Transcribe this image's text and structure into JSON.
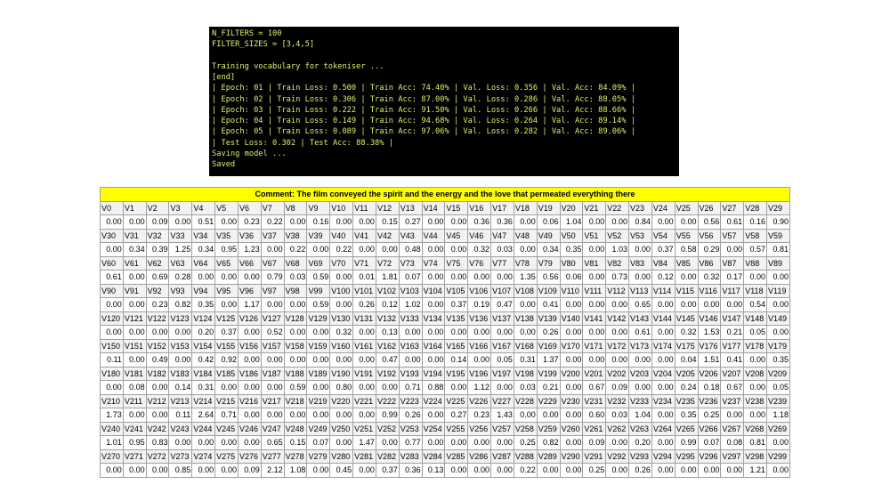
{
  "terminal": {
    "lines": [
      "N_FILTERS = 100",
      "FILTER_SIZES = [3,4,5]",
      "",
      "Training vocabulary for tokeniser ...",
      "[end]",
      "| Epoch: 01 | Train Loss: 0.500 | Train Acc: 74.40% | Val. Loss: 0.356 | Val. Acc: 84.09% |",
      "| Epoch: 02 | Train Loss: 0.306 | Train Acc: 87.00% | Val. Loss: 0.286 | Val. Acc: 88.05% |",
      "| Epoch: 03 | Train Loss: 0.222 | Train Acc: 91.50% | Val. Loss: 0.266 | Val. Acc: 88.66% |",
      "| Epoch: 04 | Train Loss: 0.149 | Train Acc: 94.68% | Val. Loss: 0.264 | Val. Acc: 89.14% |",
      "| Epoch: 05 | Train Loss: 0.089 | Train Acc: 97.06% | Val. Loss: 0.282 | Val. Acc: 89.06% |",
      "| Test Loss: 0.302 | Test Acc: 88.38% |",
      "Saving model ...",
      "Saved"
    ]
  },
  "sheet": {
    "comment": "Comment: The film conveyed the spirit and the energy and the love that permeated everything there",
    "values": [
      [
        "0.00",
        "0.00",
        "0.09",
        "0.00",
        "0.51",
        "0.00",
        "0.23",
        "0.22",
        "0.00",
        "0.16",
        "0.00",
        "0.00",
        "0.15",
        "0.27",
        "0.00",
        "0.00",
        "0.36",
        "0.36",
        "0.00",
        "0.06",
        "1.04",
        "0.00",
        "0.00",
        "0.84",
        "0.00",
        "0.00",
        "0.56",
        "0.61",
        "0.16",
        "0.90"
      ],
      [
        "0.00",
        "0.34",
        "0.39",
        "1.25",
        "0.34",
        "0.95",
        "1.23",
        "0.00",
        "0.22",
        "0.00",
        "0.22",
        "0.00",
        "0.00",
        "0.48",
        "0.00",
        "0.00",
        "0.32",
        "0.03",
        "0.00",
        "0.34",
        "0.35",
        "0.00",
        "1.03",
        "0.00",
        "0.37",
        "0.58",
        "0.29",
        "0.00",
        "0.57",
        "0.81"
      ],
      [
        "0.61",
        "0.00",
        "0.69",
        "0.28",
        "0.00",
        "0.00",
        "0.00",
        "0.79",
        "0.03",
        "0.59",
        "0.00",
        "0.01",
        "1.81",
        "0.07",
        "0.00",
        "0.00",
        "0.00",
        "0.00",
        "1.35",
        "0.56",
        "0.06",
        "0.00",
        "0.73",
        "0.00",
        "0.12",
        "0.00",
        "0.32",
        "0.17",
        "0.00",
        "0.00"
      ],
      [
        "0.00",
        "0.00",
        "0.23",
        "0.82",
        "0.35",
        "0.00",
        "1.17",
        "0.00",
        "0.00",
        "0.59",
        "0.00",
        "0.26",
        "0.12",
        "1.02",
        "0.00",
        "0.37",
        "0.19",
        "0.47",
        "0.00",
        "0.41",
        "0.00",
        "0.00",
        "0.00",
        "0.65",
        "0.00",
        "0.00",
        "0.00",
        "0.00",
        "0.54",
        "0.00"
      ],
      [
        "0.00",
        "0.00",
        "0.00",
        "0.00",
        "0.20",
        "0.37",
        "0.00",
        "0.52",
        "0.00",
        "0.00",
        "0.32",
        "0.00",
        "0.13",
        "0.00",
        "0.00",
        "0.00",
        "0.00",
        "0.00",
        "0.00",
        "0.26",
        "0.00",
        "0.00",
        "0.00",
        "0.61",
        "0.00",
        "0.32",
        "1.53",
        "0.21",
        "0.05",
        "0.00"
      ],
      [
        "0.11",
        "0.00",
        "0.49",
        "0.00",
        "0.42",
        "0.92",
        "0.00",
        "0.00",
        "0.00",
        "0.00",
        "0.00",
        "0.00",
        "0.47",
        "0.00",
        "0.00",
        "0.14",
        "0.00",
        "0.05",
        "0.31",
        "1.37",
        "0.00",
        "0.00",
        "0.00",
        "0.00",
        "0.00",
        "0.04",
        "1.51",
        "0.41",
        "0.00",
        "0.35"
      ],
      [
        "0.00",
        "0.08",
        "0.00",
        "0.14",
        "0.31",
        "0.00",
        "0.00",
        "0.00",
        "0.59",
        "0.00",
        "0.80",
        "0.00",
        "0.00",
        "0.71",
        "0.88",
        "0.00",
        "1.12",
        "0.00",
        "0.03",
        "0.21",
        "0.00",
        "0.67",
        "0.09",
        "0.00",
        "0.00",
        "0.24",
        "0.18",
        "0.67",
        "0.00",
        "0.05"
      ],
      [
        "1.73",
        "0.00",
        "0.00",
        "0.11",
        "2.64",
        "0.71",
        "0.00",
        "0.00",
        "0.00",
        "0.00",
        "0.00",
        "0.00",
        "0.99",
        "0.26",
        "0.00",
        "0.27",
        "0.23",
        "1.43",
        "0.00",
        "0.00",
        "0.00",
        "0.60",
        "0.03",
        "1.04",
        "0.00",
        "0.35",
        "0.25",
        "0.00",
        "0.00",
        "1.18"
      ],
      [
        "1.01",
        "0.95",
        "0.83",
        "0.00",
        "0.00",
        "0.00",
        "0.00",
        "0.65",
        "0.15",
        "0.07",
        "0.00",
        "1.47",
        "0.00",
        "0.77",
        "0.00",
        "0.00",
        "0.00",
        "0.00",
        "0.25",
        "0.82",
        "0.00",
        "0.09",
        "0.00",
        "0.20",
        "0.00",
        "0.99",
        "0.07",
        "0.08",
        "0.81",
        "0.00"
      ],
      [
        "0.00",
        "0.00",
        "0.00",
        "0.85",
        "0.00",
        "0.00",
        "0.09",
        "2.12",
        "1.08",
        "0.00",
        "0.45",
        "0.00",
        "0.37",
        "0.36",
        "0.13",
        "0.00",
        "0.00",
        "0.00",
        "0.22",
        "0.00",
        "0.00",
        "0.25",
        "0.00",
        "0.26",
        "0.00",
        "0.00",
        "0.00",
        "0.00",
        "1.21",
        "0.00"
      ]
    ]
  }
}
